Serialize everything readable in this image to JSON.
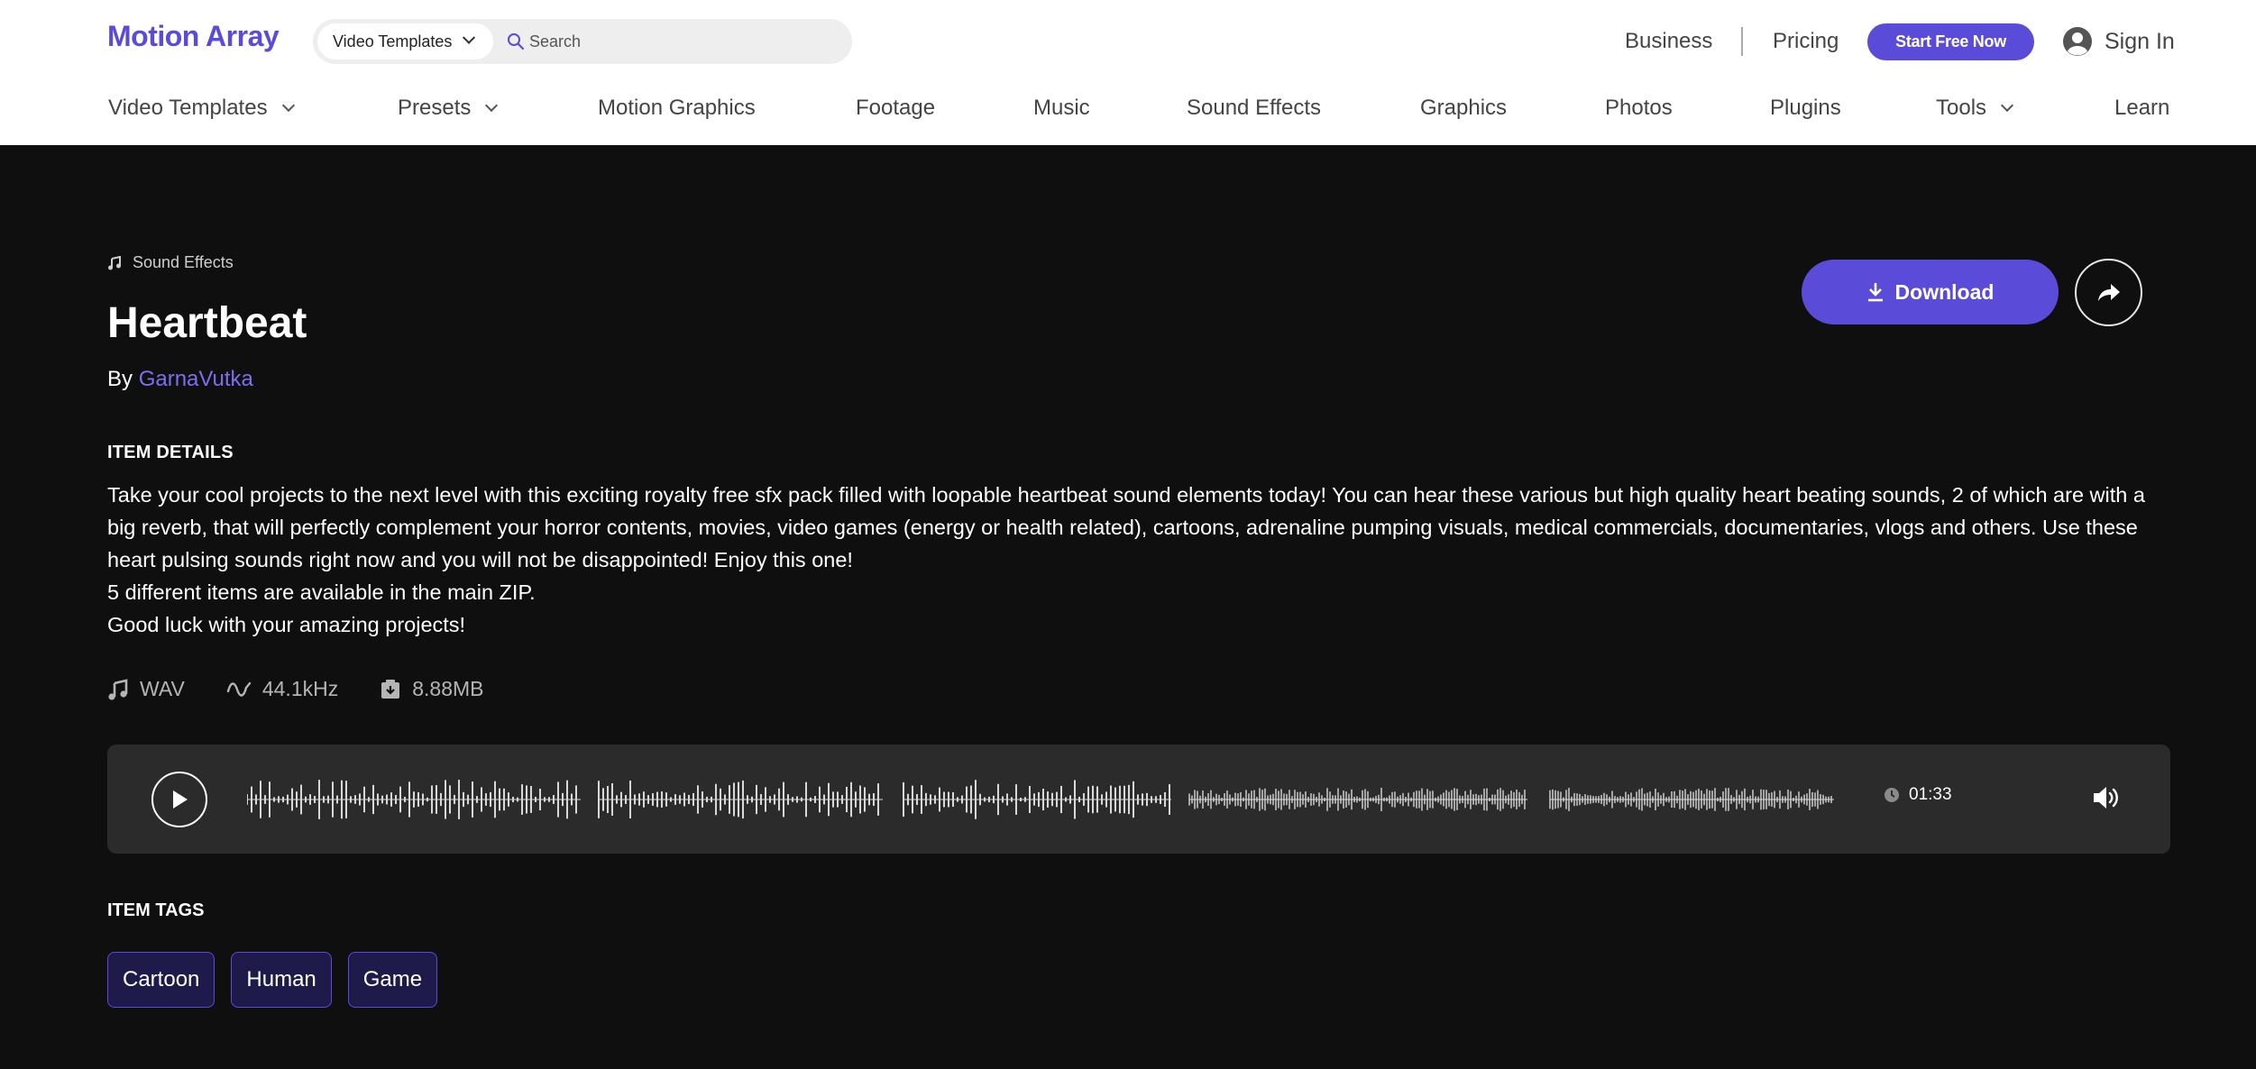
{
  "header": {
    "logo": "Motion Array",
    "search": {
      "category": "Video Templates",
      "placeholder": "Search"
    },
    "links": {
      "business": "Business",
      "pricing": "Pricing"
    },
    "cta": "Start Free Now",
    "signin": "Sign In",
    "accent": "#5a4bd9"
  },
  "nav": {
    "items": [
      {
        "label": "Video Templates",
        "dropdown": true
      },
      {
        "label": "Presets",
        "dropdown": true
      },
      {
        "label": "Motion Graphics",
        "dropdown": false
      },
      {
        "label": "Footage",
        "dropdown": false
      },
      {
        "label": "Music",
        "dropdown": false
      },
      {
        "label": "Sound Effects",
        "dropdown": false
      },
      {
        "label": "Graphics",
        "dropdown": false
      },
      {
        "label": "Photos",
        "dropdown": false
      },
      {
        "label": "Plugins",
        "dropdown": false
      },
      {
        "label": "Tools",
        "dropdown": true
      },
      {
        "label": "Learn",
        "dropdown": false
      }
    ]
  },
  "item": {
    "category": "Sound Effects",
    "category_icon": "music-note-icon",
    "title": "Heartbeat",
    "by": "By",
    "author": "GarnaVutka",
    "download": "Download",
    "share_icon": "share-icon",
    "details_heading": "ITEM DETAILS",
    "description": [
      "Take your cool projects to the next level with this exciting royalty free sfx pack filled with loopable heartbeat sound elements today! You can hear these various but high quality heart beating sounds, 2 of which are with a big reverb, that will perfectly complement your horror contents, movies, video games (energy or health related), cartoons, adrenaline pumping visuals, medical commercials, documentaries, vlogs and others. Use these heart pulsing sounds right now and you will not be disappointed! Enjoy this one!",
      "5 different items are available in the main ZIP.",
      "Good luck with your amazing projects!"
    ],
    "meta": {
      "format": "WAV",
      "sample_rate": "44.1kHz",
      "size": "8.88MB"
    }
  },
  "player": {
    "duration": "01:33",
    "play_icon": "play-icon",
    "volume_icon": "volume-icon"
  },
  "tags": {
    "heading": "ITEM TAGS",
    "items": [
      "Cartoon",
      "Human",
      "Game"
    ]
  }
}
